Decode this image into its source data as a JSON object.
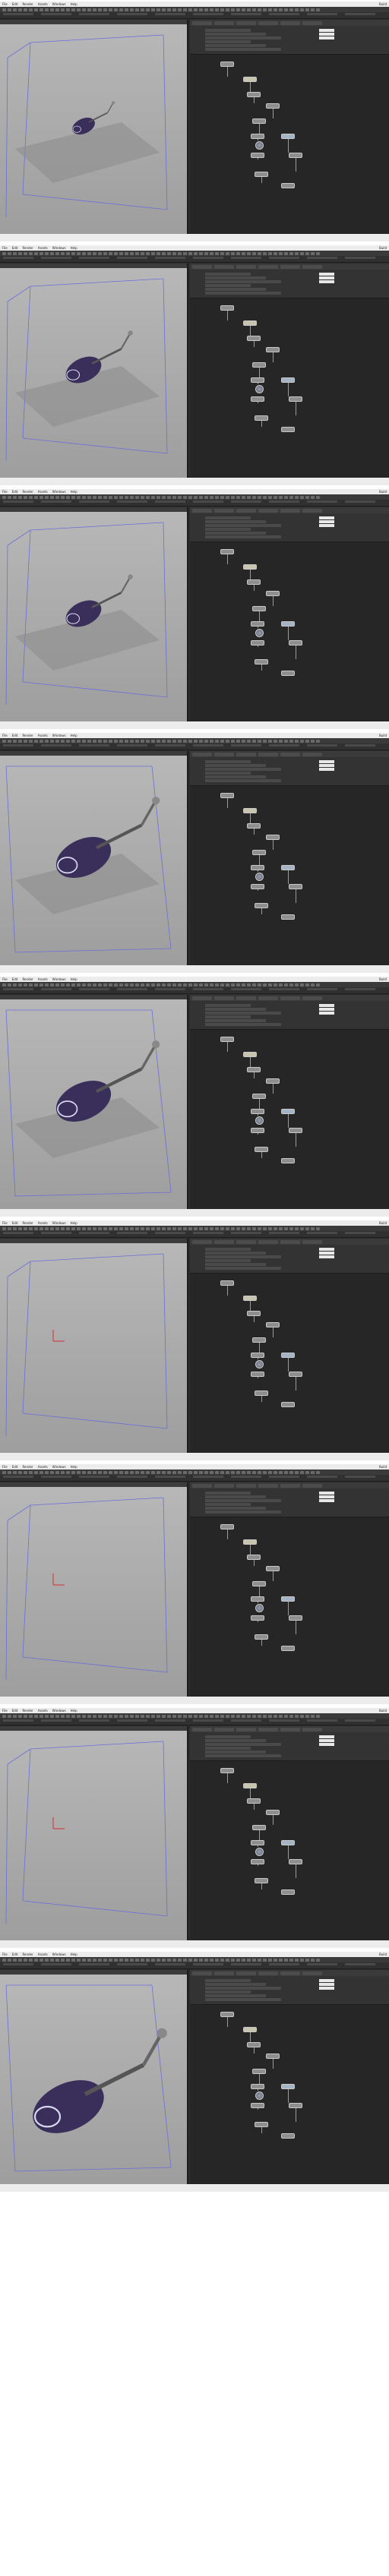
{
  "app": {
    "menu_items": [
      "File",
      "Edit",
      "Render",
      "Assets",
      "Windows",
      "Help"
    ],
    "desktop_label": "Build"
  },
  "frames": [
    {
      "variant": "small-robot",
      "grid": true,
      "node_label_a": "",
      "node_label_b": ""
    },
    {
      "variant": "mid-robot",
      "grid": true,
      "node_label_a": "",
      "node_label_b": ""
    },
    {
      "variant": "mid-robot",
      "grid": true,
      "node_label_a": "",
      "node_label_b": ""
    },
    {
      "variant": "large-robot",
      "grid": true,
      "node_label_a": "",
      "node_label_b": ""
    },
    {
      "variant": "large-robot",
      "grid": true,
      "node_label_a": "",
      "node_label_b": ""
    },
    {
      "variant": "empty-axes",
      "grid": false,
      "node_label_a": "",
      "node_label_b": ""
    },
    {
      "variant": "empty-axes",
      "grid": false,
      "node_label_a": "",
      "node_label_b": ""
    },
    {
      "variant": "empty-axes",
      "grid": false,
      "node_label_a": "",
      "node_label_b": ""
    },
    {
      "variant": "closeup-robot",
      "grid": false,
      "node_label_a": "",
      "node_label_b": ""
    }
  ],
  "colors": {
    "viewport_bg": "#b0b0b0",
    "network_bg": "#262626",
    "robot_body": "#3a2f5a",
    "bbox_line": "#6a6fd8",
    "axis_red": "#d03030"
  }
}
